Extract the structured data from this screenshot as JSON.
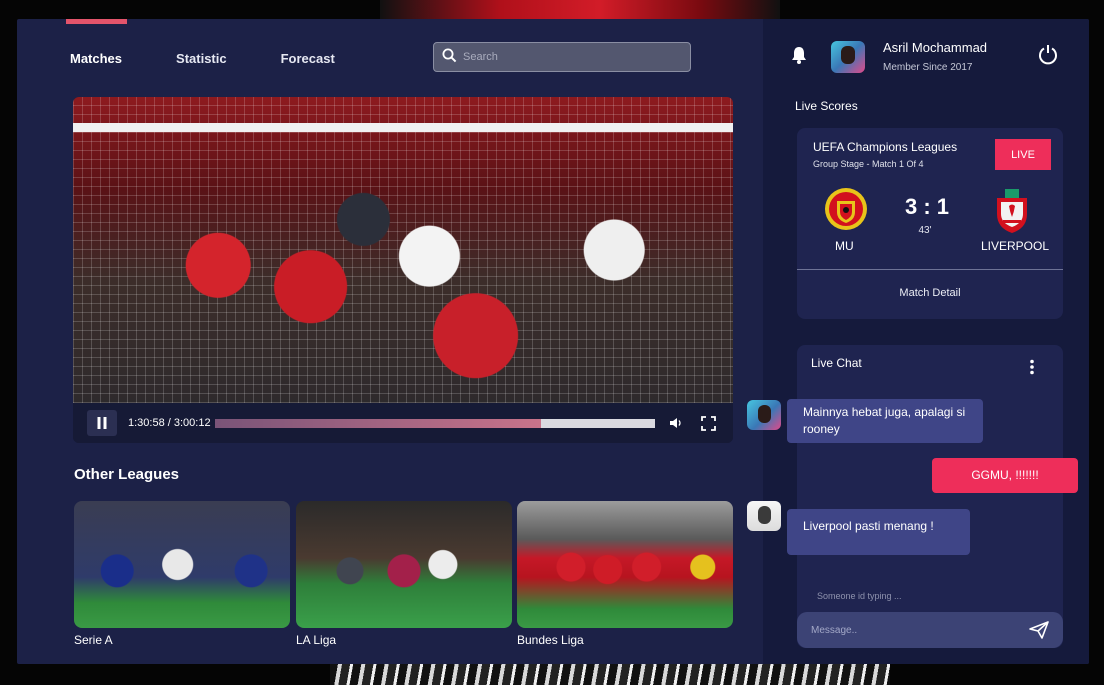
{
  "nav": {
    "items": [
      {
        "label": "Matches",
        "active": true
      },
      {
        "label": "Statistic",
        "active": false
      },
      {
        "label": "Forecast",
        "active": false
      }
    ]
  },
  "search": {
    "placeholder": "Search",
    "value": ""
  },
  "player": {
    "time_display": "1:30:58 / 3:00:12",
    "progress": 0.743
  },
  "other_leagues": {
    "title": "Other Leagues",
    "items": [
      {
        "name": "Serie A"
      },
      {
        "name": "LA Liga"
      },
      {
        "name": "Bundes Liga"
      }
    ]
  },
  "user": {
    "name": "Asril Mochammad",
    "subtitle": "Member Since 2017"
  },
  "live_scores": {
    "title": "Live Scores",
    "competition": "UEFA Champions Leagues",
    "stage": "Group Stage - Match 1 Of 4",
    "badge": "LIVE",
    "home_team": "MU",
    "away_team": "LIVERPOOL",
    "score": "3 : 1",
    "minute": "43'",
    "detail_link": "Match Detail"
  },
  "chat": {
    "title": "Live Chat",
    "messages": [
      {
        "text": "Mainnya hebat juga, apalagi si rooney",
        "mine": false
      },
      {
        "text": "GGMU, !!!!!!!",
        "mine": true
      },
      {
        "text": "Liverpool pasti menang !",
        "mine": false
      }
    ],
    "typing": "Someone id typing ...",
    "input_placeholder": "Message.."
  },
  "colors": {
    "accent": "#ee2e5a",
    "panel": "#1c2147",
    "sidebar": "#151a3c",
    "card": "#1f2450",
    "nav_indicator": "#e3546b"
  }
}
